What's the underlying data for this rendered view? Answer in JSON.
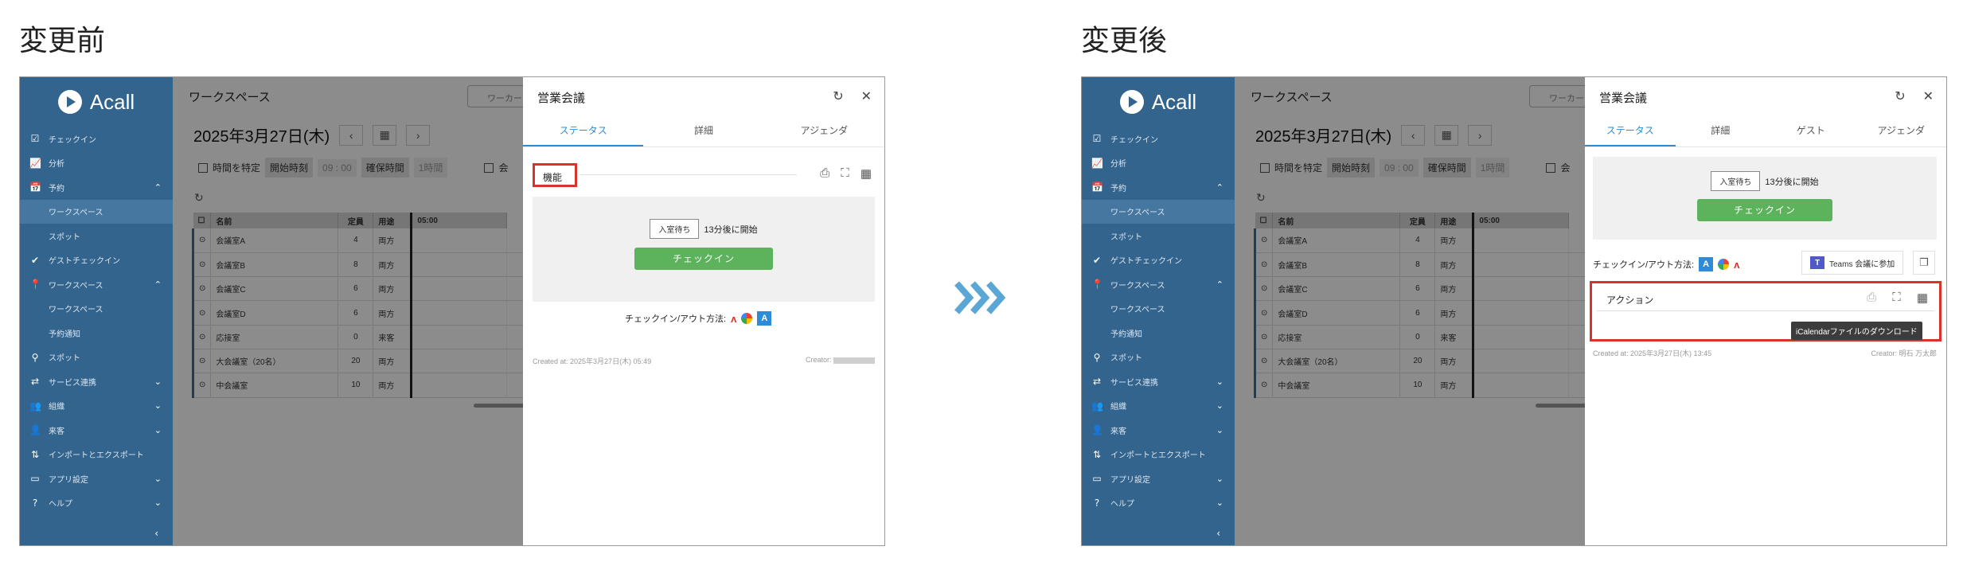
{
  "headings": {
    "before": "変更前",
    "after": "変更後"
  },
  "sidebar": {
    "logo": "Acall",
    "items": [
      {
        "icon": "checkbox-icon",
        "glyph": "☑",
        "label": "チェックイン",
        "sub": false,
        "active": false,
        "chev": ""
      },
      {
        "icon": "chart-icon",
        "glyph": "📈",
        "label": "分析",
        "sub": false,
        "active": false,
        "chev": ""
      },
      {
        "icon": "calendar-icon",
        "glyph": "📅",
        "label": "予約",
        "sub": false,
        "active": false,
        "chev": "⌃"
      },
      {
        "icon": "",
        "glyph": "",
        "label": "ワークスペース",
        "sub": true,
        "active": true,
        "chev": ""
      },
      {
        "icon": "",
        "glyph": "",
        "label": "スポット",
        "sub": true,
        "active": false,
        "chev": ""
      },
      {
        "icon": "check-icon",
        "glyph": "✔",
        "label": "ゲストチェックイン",
        "sub": false,
        "active": false,
        "chev": ""
      },
      {
        "icon": "pin-icon",
        "glyph": "📍",
        "label": "ワークスペース",
        "sub": false,
        "active": false,
        "chev": "⌃"
      },
      {
        "icon": "",
        "glyph": "",
        "label": "ワークスペース",
        "sub": true,
        "active": false,
        "chev": ""
      },
      {
        "icon": "",
        "glyph": "",
        "label": "予約通知",
        "sub": true,
        "active": false,
        "chev": ""
      },
      {
        "icon": "spot-pin-icon",
        "glyph": "⚲",
        "label": "スポット",
        "sub": false,
        "active": false,
        "chev": ""
      },
      {
        "icon": "service-icon",
        "glyph": "⇄",
        "label": "サービス連携",
        "sub": false,
        "active": false,
        "chev": "⌄"
      },
      {
        "icon": "organization-icon",
        "glyph": "👥",
        "label": "組織",
        "sub": false,
        "active": false,
        "chev": "⌄"
      },
      {
        "icon": "visitor-icon",
        "glyph": "👤",
        "label": "来客",
        "sub": false,
        "active": false,
        "chev": "⌄"
      },
      {
        "icon": "import-export-icon",
        "glyph": "⇅",
        "label": "インポートとエクスポート",
        "sub": false,
        "active": false,
        "chev": ""
      },
      {
        "icon": "app-settings-icon",
        "glyph": "▭",
        "label": "アプリ設定",
        "sub": false,
        "active": false,
        "chev": "⌄"
      },
      {
        "icon": "help-icon",
        "glyph": "?",
        "label": "ヘルプ",
        "sub": false,
        "active": false,
        "chev": "⌄"
      }
    ],
    "collapse": "‹"
  },
  "workspace": {
    "title": "ワークスペース",
    "search_placeholder": "ワーカー",
    "date": "2025年3月27日(木)",
    "prev": "‹",
    "next": "›",
    "specify_time": "時間を特定",
    "start_time_label": "開始時刻",
    "start_time_value": "09 : 00",
    "duration_label": "確保時間",
    "duration_value": "1時間",
    "extra_filter": "会",
    "table": {
      "headers": [
        "名前",
        "定員",
        "用途",
        "05:00"
      ],
      "rows": [
        [
          "会議室A",
          "4",
          "両方"
        ],
        [
          "会議室B",
          "8",
          "両方"
        ],
        [
          "会議室C",
          "6",
          "両方"
        ],
        [
          "会議室D",
          "6",
          "両方"
        ],
        [
          "応接室",
          "0",
          "来客"
        ],
        [
          "大会議室（20名）",
          "20",
          "両方"
        ],
        [
          "中会議室",
          "10",
          "両方"
        ]
      ]
    }
  },
  "drawer": {
    "title": "営業会議",
    "before_tabs": [
      "ステータス",
      "詳細",
      "アジェンダ"
    ],
    "after_tabs": [
      "ステータス",
      "詳細",
      "ゲスト",
      "アジェンダ"
    ],
    "function_label": "機能",
    "wait_label": "入室待ち",
    "start_in": "13分後に開始",
    "checkin_button": "チェックイン",
    "before_methods_label": "チェックイン/アウト方法:",
    "after_methods_label": "チェックイン/アウト方法:",
    "before_created": "Created at: 2025年3月27日(木) 05:49",
    "before_creator": "Creator:",
    "after_created": "Created at: 2025年3月27日(木) 13:45",
    "after_creator": "Creator: 明石 万太郎",
    "teams_button": "Teams 会議に参加",
    "action_label": "アクション",
    "tooltip": "iCalendarファイルのダウンロード"
  }
}
